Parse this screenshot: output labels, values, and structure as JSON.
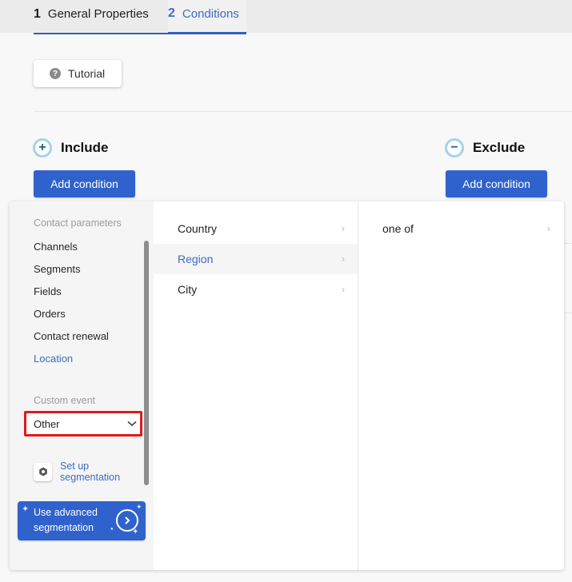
{
  "tabs": [
    {
      "number": "1",
      "label": "General Properties",
      "active": false
    },
    {
      "number": "2",
      "label": "Conditions",
      "active": true
    }
  ],
  "tutorial": {
    "label": "Tutorial",
    "icon": "question-circle-icon"
  },
  "include": {
    "title": "Include",
    "icon": "plus-circle-icon",
    "button_label": "Add condition"
  },
  "exclude": {
    "title": "Exclude",
    "icon": "minus-circle-icon",
    "button_label": "Add condition"
  },
  "menu": {
    "contact_parameters_label": "Contact parameters",
    "categories": [
      {
        "label": "Channels",
        "active": false
      },
      {
        "label": "Segments",
        "active": false
      },
      {
        "label": "Fields",
        "active": false
      },
      {
        "label": "Orders",
        "active": false
      },
      {
        "label": "Contact renewal",
        "active": false
      },
      {
        "label": "Location",
        "active": true
      }
    ],
    "custom_event_label": "Custom event",
    "custom_event_select": {
      "value": "Other"
    },
    "setup_link": {
      "line1": "Set up",
      "line2": "segmentation",
      "icon": "gear-icon"
    },
    "advanced_button": {
      "line1": "Use advanced",
      "line2": "segmentation",
      "icon": "chevron-right-circle-icon"
    },
    "location_options": [
      {
        "label": "Country",
        "active": false
      },
      {
        "label": "Region",
        "active": true
      },
      {
        "label": "City",
        "active": false
      }
    ],
    "operators": [
      {
        "label": "one of"
      }
    ]
  },
  "colors": {
    "accent": "#2f62cc",
    "active_text": "#3b6cc4",
    "highlight_border": "#e01b1b"
  }
}
